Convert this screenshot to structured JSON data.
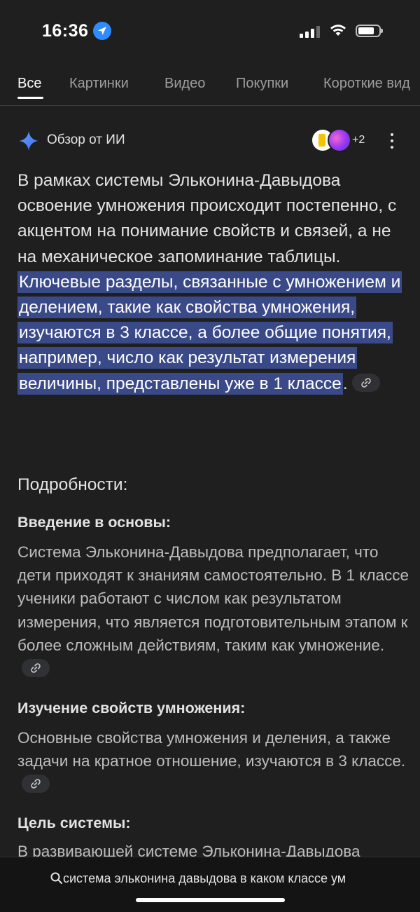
{
  "status": {
    "time": "16:36",
    "icons": [
      "location-arrow-icon",
      "signal-icon",
      "wifi-icon",
      "battery-icon"
    ]
  },
  "tabs": [
    {
      "label": "Все",
      "active": true
    },
    {
      "label": "Картинки",
      "active": false
    },
    {
      "label": "Видео",
      "active": false
    },
    {
      "label": "Покупки",
      "active": false
    },
    {
      "label": "Короткие вид",
      "active": false
    }
  ],
  "ai_overview": {
    "title": "Обзор от ИИ",
    "sources_more": "+2",
    "summary_plain": "В рамках системы Эльконина-Давыдова освоение умножения происходит постепенно, с акцентом на понимание свойств и связей, а не на механическое запоминание таблицы.",
    "summary_highlight": "Ключевые разделы, связанные с умножением и делением, такие как свойства умножения, изучаются в 3 классе, а более общие понятия, например, число как результат измерения величины, представлены уже в 1 классе",
    "summary_end": "."
  },
  "details": {
    "heading": "Подробности:",
    "sections": [
      {
        "title": "Введение в основы:",
        "text": "Система Эльконина-Давыдова предполагает, что дети приходят к знаниям самостоятельно. В 1 классе ученики работают с числом как результатом измерения, что является подготовительным этапом к более сложным действиям, таким как умножение."
      },
      {
        "title": "Изучение свойств умножения:",
        "text": "Основные свойства умножения и деления, а также задачи на кратное отношение, изучаются в 3 классе."
      },
      {
        "title": "Цель системы:",
        "text": "В развивающей системе Эльконина-Давыдова"
      }
    ]
  },
  "bottom_bar": {
    "query": "система эльконина давыдова в каком классе ум"
  },
  "colors": {
    "background": "#1f1f1f",
    "highlight": "#3a4a89",
    "location_blue": "#2f8cff"
  }
}
